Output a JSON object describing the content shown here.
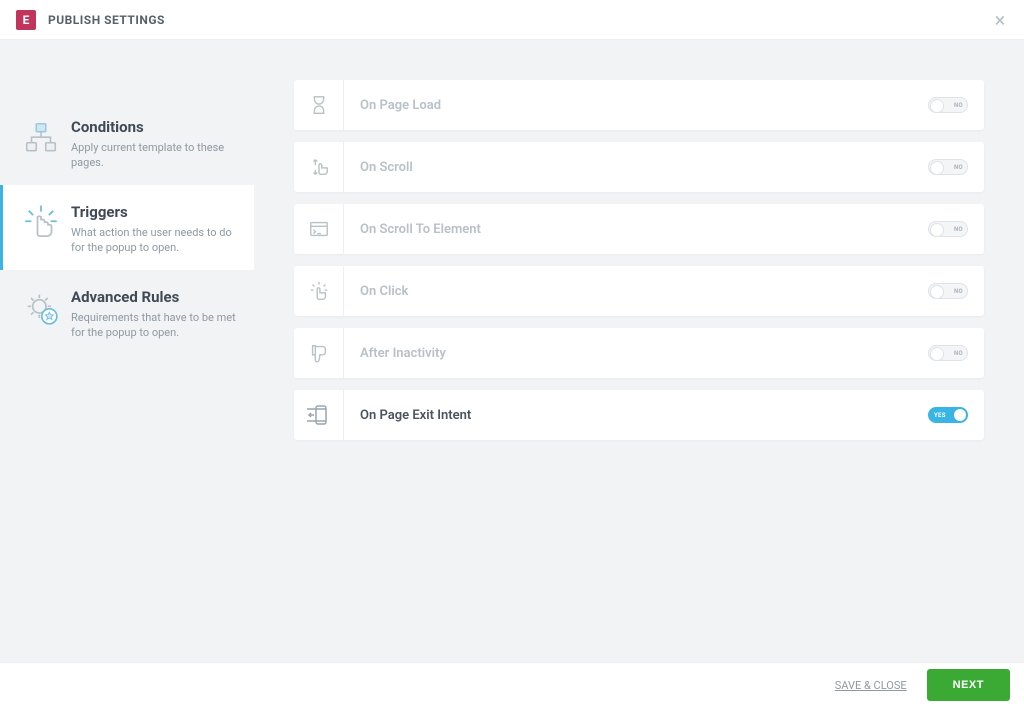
{
  "header": {
    "title": "PUBLISH SETTINGS",
    "logo_letter": "E"
  },
  "sidebar": {
    "items": [
      {
        "id": "conditions",
        "title": "Conditions",
        "desc": "Apply current template to these pages.",
        "active": false
      },
      {
        "id": "triggers",
        "title": "Triggers",
        "desc": "What action the user needs to do for the popup to open.",
        "active": true
      },
      {
        "id": "advanced",
        "title": "Advanced Rules",
        "desc": "Requirements that have to be met for the popup to open.",
        "active": false
      }
    ]
  },
  "triggers": [
    {
      "id": "page-load",
      "label": "On Page Load",
      "enabled": false
    },
    {
      "id": "scroll",
      "label": "On Scroll",
      "enabled": false
    },
    {
      "id": "scroll-element",
      "label": "On Scroll To Element",
      "enabled": false
    },
    {
      "id": "click",
      "label": "On Click",
      "enabled": false
    },
    {
      "id": "inactivity",
      "label": "After Inactivity",
      "enabled": false
    },
    {
      "id": "exit-intent",
      "label": "On Page Exit Intent",
      "enabled": true
    }
  ],
  "toggle": {
    "on_label": "YES",
    "off_label": "NO"
  },
  "footer": {
    "save_close": "SAVE & CLOSE",
    "next": "NEXT"
  }
}
